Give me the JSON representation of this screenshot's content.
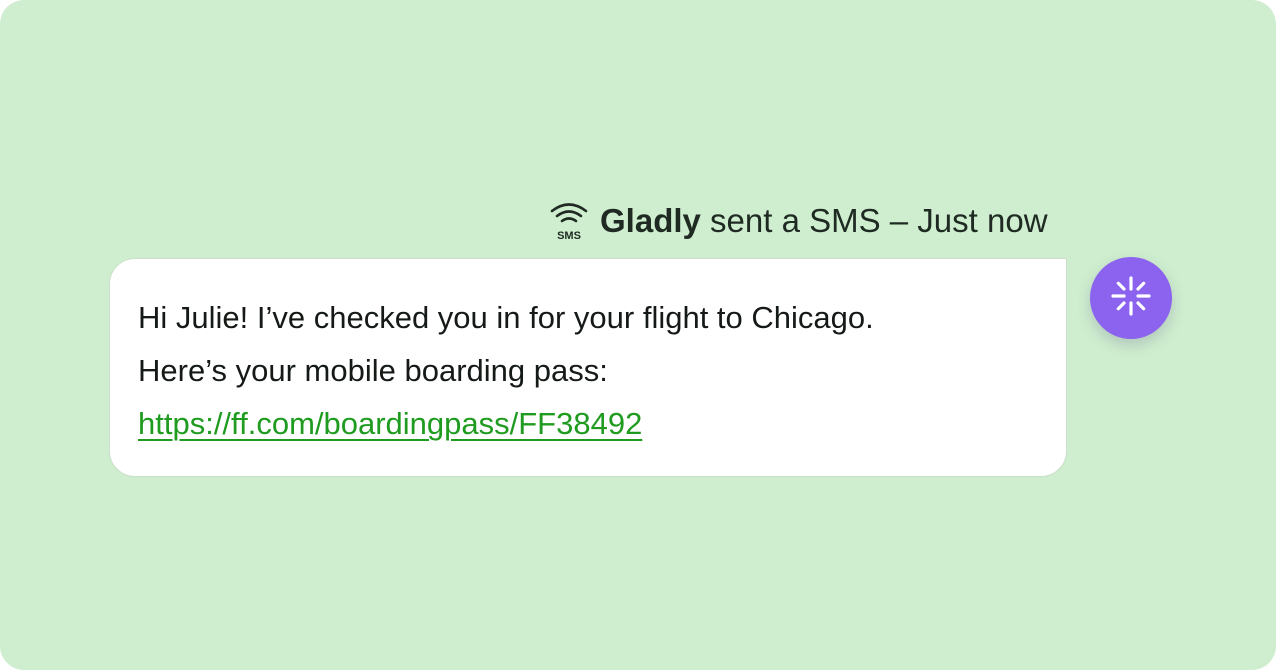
{
  "message": {
    "channel_icon": "sms-signal-icon",
    "channel_icon_label": "SMS",
    "sender": "Gladly",
    "status_text": "sent a SMS – Just now",
    "lines": [
      "Hi Julie! I’ve checked you in for your flight to Chicago.",
      "Here’s your mobile boarding pass:"
    ],
    "link_text": "https://ff.com/boardingpass/FF38492"
  },
  "avatar": {
    "icon": "sparkle-burst-icon"
  },
  "colors": {
    "background": "#cfeecf",
    "bubble": "#ffffff",
    "link": "#1f9b1f",
    "avatar": "#8b63ee",
    "text": "#151a16"
  }
}
